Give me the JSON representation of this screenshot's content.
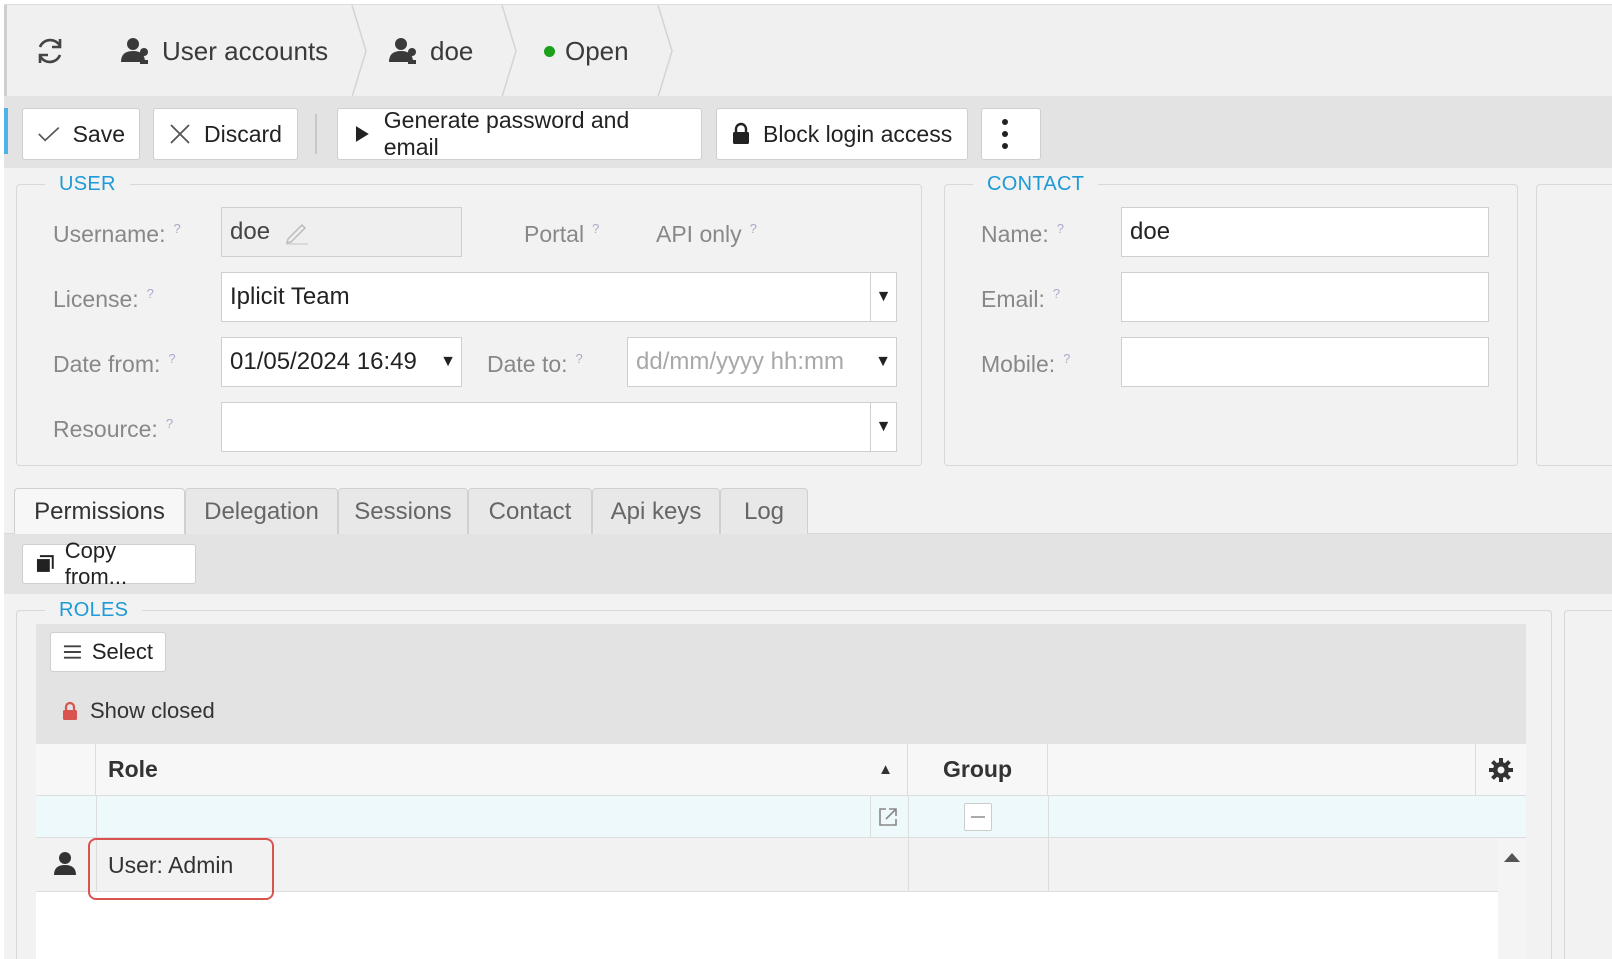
{
  "breadcrumbs": {
    "refresh_icon": "refresh-icon",
    "items": [
      {
        "label": "User accounts",
        "icon": "users-icon"
      },
      {
        "label": "doe",
        "icon": "user-icon"
      },
      {
        "label": "Open",
        "status_color": "#1aa01a"
      }
    ]
  },
  "toolbar": {
    "save": "Save",
    "discard": "Discard",
    "generate": "Generate password and email",
    "block": "Block login access",
    "more_icon": "more-vertical-icon"
  },
  "user_section": {
    "legend": "USER",
    "username_label": "Username:",
    "username_value": "doe",
    "portal_label": "Portal",
    "api_only_label": "API only",
    "license_label": "License:",
    "license_value": "Iplicit Team",
    "date_from_label": "Date from:",
    "date_from_value": "01/05/2024 16:49",
    "date_to_label": "Date to:",
    "date_to_placeholder": "dd/mm/yyyy hh:mm",
    "resource_label": "Resource:",
    "resource_value": "",
    "help_mark": "?"
  },
  "contact_section": {
    "legend": "CONTACT",
    "name_label": "Name:",
    "name_value": "doe",
    "email_label": "Email:",
    "email_value": "",
    "mobile_label": "Mobile:",
    "mobile_value": ""
  },
  "tabs": [
    {
      "label": "Permissions",
      "active": true
    },
    {
      "label": "Delegation",
      "active": false
    },
    {
      "label": "Sessions",
      "active": false
    },
    {
      "label": "Contact",
      "active": false
    },
    {
      "label": "Api keys",
      "active": false
    },
    {
      "label": "Log",
      "active": false
    }
  ],
  "permissions": {
    "copy_from": "Copy from...",
    "roles_legend": "ROLES",
    "select_button": "Select",
    "show_closed": "Show closed",
    "columns": {
      "role": "Role",
      "group": "Group"
    },
    "sort_indicator": "▲",
    "rows": [
      {
        "role": "User: Admin",
        "group": ""
      }
    ],
    "colors": {
      "highlight": "#d9534f",
      "accent": "#1e9ad6",
      "lock": "#d9534f"
    }
  }
}
